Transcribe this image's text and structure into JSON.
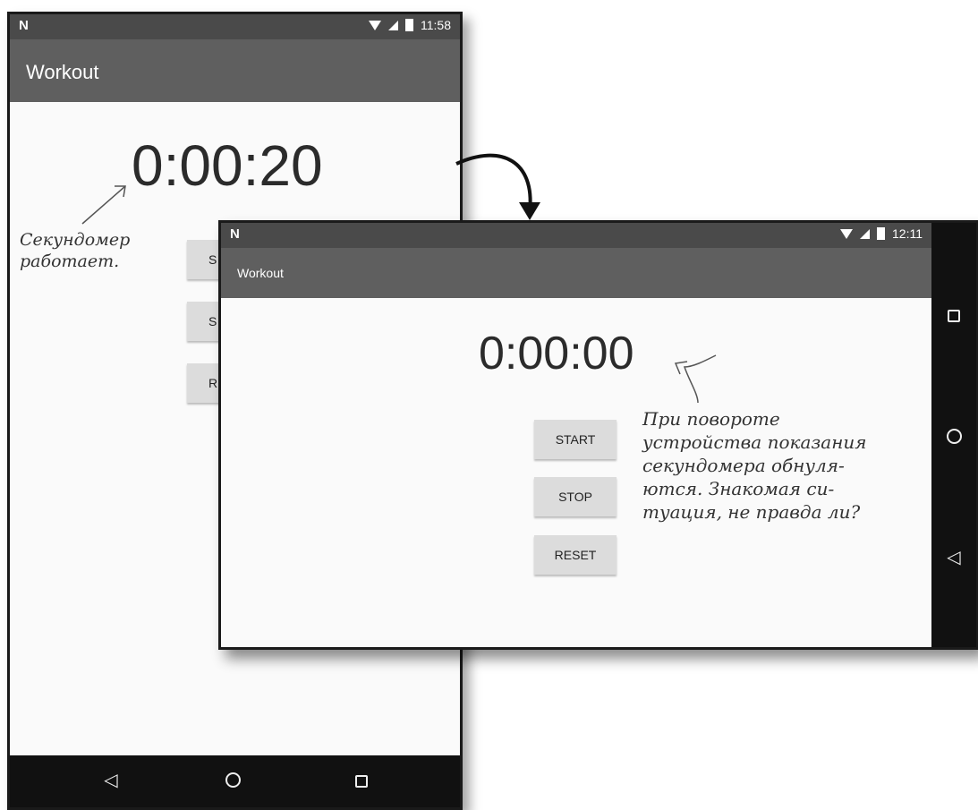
{
  "portrait": {
    "status": {
      "logo": "N",
      "time": "11:58"
    },
    "app_title": "Workout",
    "timer": "0:00:20",
    "buttons": {
      "start": "S",
      "stop": "S",
      "reset": "R"
    },
    "nav": {
      "back": "back-icon",
      "home": "home-icon",
      "recents": "recents-icon"
    }
  },
  "landscape": {
    "status": {
      "logo": "N",
      "time": "12:11"
    },
    "app_title": "Workout",
    "timer": "0:00:00",
    "buttons": {
      "start": "START",
      "stop": "STOP",
      "reset": "RESET"
    },
    "nav": {
      "recents": "recents-icon",
      "home": "home-icon",
      "back": "back-icon"
    }
  },
  "annotations": {
    "left": "Секундомер\nработает.",
    "right": "При повороте\nустройства показания\nсекундомера обнуля-\nются. Знакомая си-\nтуация, не правда ли?"
  },
  "colors": {
    "appbar": "#5f5f5f",
    "statusbar": "#4a4a4a",
    "navbar": "#111111",
    "button": "#dcdcdc"
  }
}
